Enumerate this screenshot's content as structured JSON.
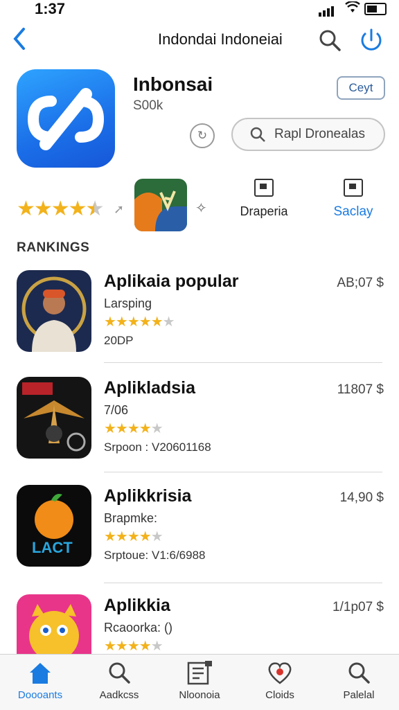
{
  "status": {
    "time": "1:37"
  },
  "nav": {
    "title": "Indondai Indoneiai"
  },
  "app": {
    "name": "Inbonsai",
    "count": "S00k",
    "get_label": "Ceyt",
    "search_placeholder": "Rapl Dronealas",
    "rating": 4.5,
    "option1_label": "Draperia",
    "option2_label": "Saclay"
  },
  "section": {
    "title": "RANKINGS"
  },
  "rankings": [
    {
      "title": "Aplikaia popular",
      "subtitle": "Larsping",
      "rating": 5,
      "info": "20DP",
      "price": "AB;07 $"
    },
    {
      "title": "Aplikladsia",
      "subtitle": "7/06",
      "rating": 4,
      "info": "Srpoon : V20601168",
      "price": "11807 $"
    },
    {
      "title": "Aplikkrisia",
      "subtitle": "Brapmke:",
      "rating": 4,
      "info": "Srptoue: V1:6/6988",
      "price": "14,90 $"
    },
    {
      "title": "Aplikkia",
      "subtitle": "Rcaoorka: ()",
      "rating": 4,
      "info": "",
      "price": "1/1p07 $"
    }
  ],
  "tabs": [
    {
      "label": "Doooants",
      "icon": "home-icon"
    },
    {
      "label": "Aadkcss",
      "icon": "search-icon"
    },
    {
      "label": "Nloonoia",
      "icon": "news-icon"
    },
    {
      "label": "Cloids",
      "icon": "heart-icon"
    },
    {
      "label": "Palelal",
      "icon": "search-icon"
    }
  ],
  "colors": {
    "accent": "#1a7be0",
    "star": "#f2b21b"
  }
}
